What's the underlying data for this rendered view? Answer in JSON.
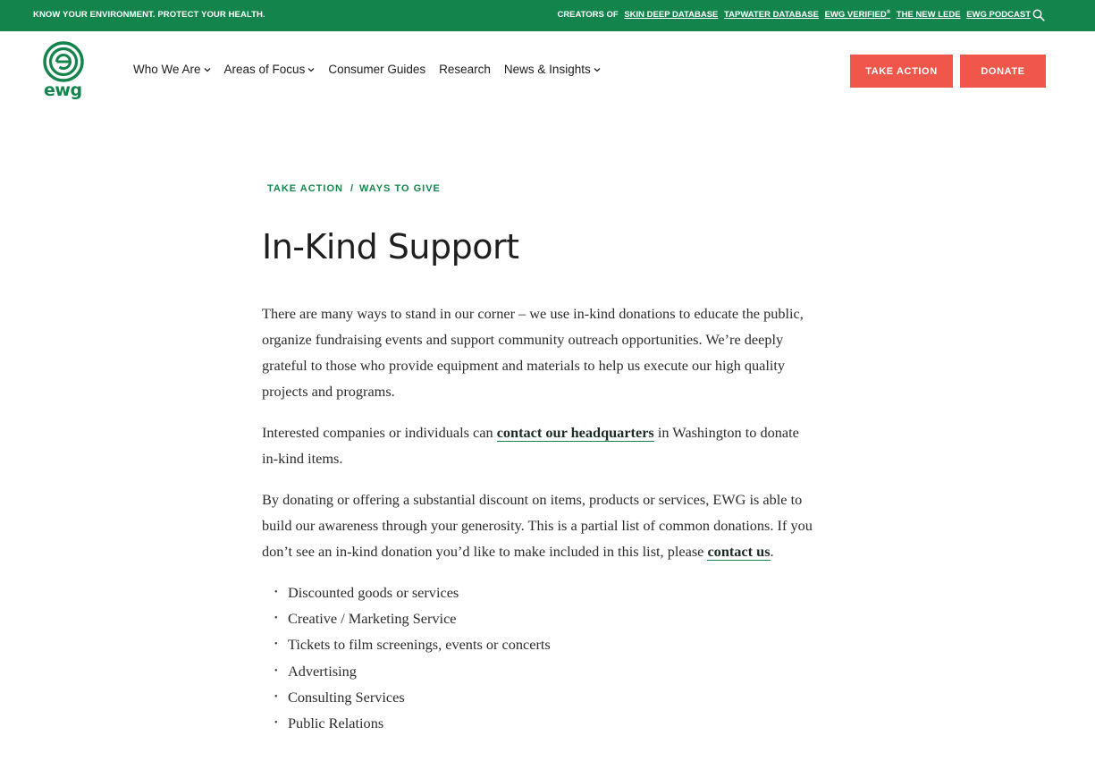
{
  "topbar": {
    "tagline": "KNOW YOUR ENVIRONMENT. PROTECT YOUR HEALTH.",
    "creators_label": "CREATORS OF",
    "links": [
      "SKIN DEEP DATABASE",
      "TAPWATER DATABASE",
      "EWG VERIFIED",
      "THE NEW LEDE",
      "EWG PODCAST"
    ],
    "ewg_verified_mark": "®"
  },
  "logo": {
    "text": "ewg"
  },
  "nav": {
    "items": [
      "Who We Are",
      "Areas of Focus",
      "Consumer Guides",
      "Research",
      "News & Insights"
    ]
  },
  "buttons": {
    "take_action": "TAKE ACTION",
    "donate": "DONATE"
  },
  "breadcrumb": {
    "first": "TAKE ACTION",
    "separator": "/",
    "second": "WAYS TO GIVE"
  },
  "page": {
    "title": "In-Kind Support",
    "p1": "There are many ways to stand in our corner – we use in-kind donations to educate the public, organize fundraising events and support community outreach opportunities. We’re deeply grateful to those who provide equipment and materials to help us execute our high quality projects and programs.",
    "p2_before": "Interested companies or individuals can ",
    "p2_link": "contact our headquarters",
    "p2_after": " in Washington to donate in-kind items.",
    "p3_before": "By donating or offering a substantial discount on items, products or services, EWG is able to build our awareness through your generosity. This is a partial list of common donations. If you don’t see an in-kind donation you’d like to make included in this list, please ",
    "p3_link": "contact us",
    "p3_after": ".",
    "list": [
      "Discounted goods or services",
      "Creative / Marketing Service",
      "Tickets to film screenings, events or concerts",
      "Advertising",
      "Consulting Services",
      "Public Relations"
    ]
  },
  "colors": {
    "brand_green": "#13854c",
    "button_red": "#f0564a"
  }
}
